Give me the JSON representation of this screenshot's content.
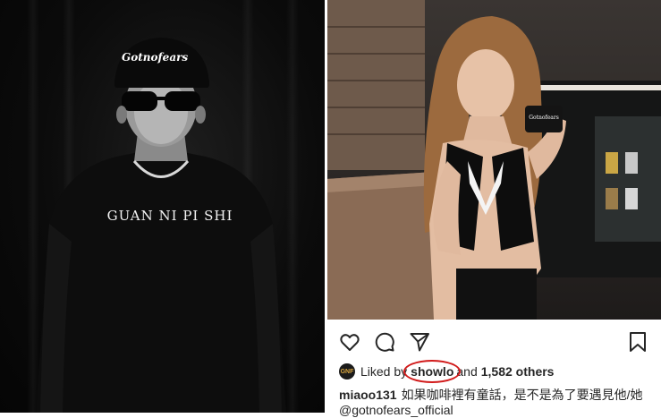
{
  "left_photo": {
    "cap_text": "Gotnofears",
    "shirt_text": "GUAN NI PI SHI"
  },
  "right_photo": {
    "mug_text": "Gotnofears"
  },
  "instagram": {
    "icons": [
      "heart-icon",
      "comment-icon",
      "share-icon",
      "bookmark-icon"
    ],
    "avatar_text": "GNF",
    "liked_by_label": "Liked by",
    "liked_user": "showlo",
    "and_label": "and",
    "others_count": "1,582 others",
    "caption_user": "miaoo131",
    "caption_text": "如果咖啡裡有童話，是不是為了要遇見他/她",
    "caption_mention": "@gotnofears_official",
    "highlight_color": "#d11a1a"
  }
}
